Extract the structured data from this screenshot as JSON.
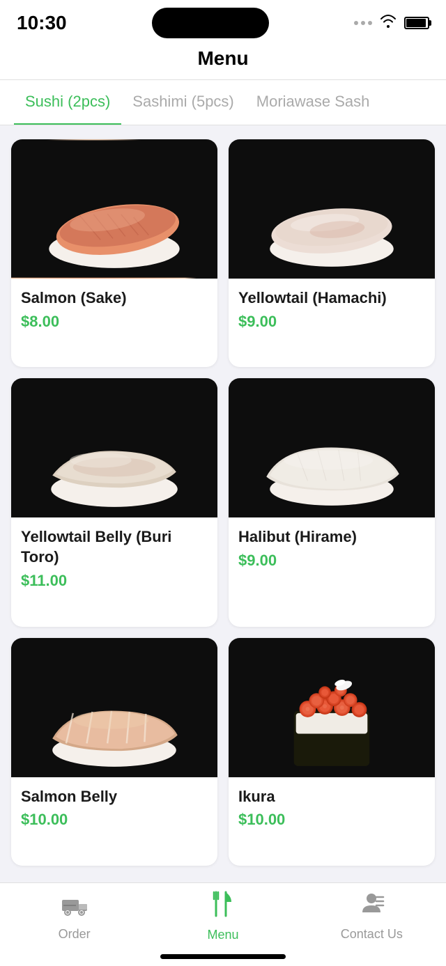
{
  "statusBar": {
    "time": "10:30"
  },
  "header": {
    "title": "Menu"
  },
  "tabs": [
    {
      "id": "sushi",
      "label": "Sushi (2pcs)",
      "active": true
    },
    {
      "id": "sashimi",
      "label": "Sashimi (5pcs)",
      "active": false
    },
    {
      "id": "moriawase",
      "label": "Moriawase Sash",
      "active": false
    }
  ],
  "menuItems": [
    {
      "id": 1,
      "name": "Salmon (Sake)",
      "price": "$8.00",
      "type": "salmon"
    },
    {
      "id": 2,
      "name": "Yellowtail (Hamachi)",
      "price": "$9.00",
      "type": "yellowtail"
    },
    {
      "id": 3,
      "name": "Yellowtail Belly (Buri Toro)",
      "price": "$11.00",
      "type": "belly"
    },
    {
      "id": 4,
      "name": "Halibut (Hirame)",
      "price": "$9.00",
      "type": "halibut"
    },
    {
      "id": 5,
      "name": "Salmon Belly",
      "price": "$10.00",
      "type": "belly2"
    },
    {
      "id": 6,
      "name": "Ikura",
      "price": "$10.00",
      "type": "ikura"
    }
  ],
  "bottomNav": [
    {
      "id": "order",
      "label": "Order",
      "icon": "order",
      "active": false
    },
    {
      "id": "menu",
      "label": "Menu",
      "icon": "menu",
      "active": true
    },
    {
      "id": "contact",
      "label": "Contact Us",
      "icon": "contact",
      "active": false
    }
  ]
}
